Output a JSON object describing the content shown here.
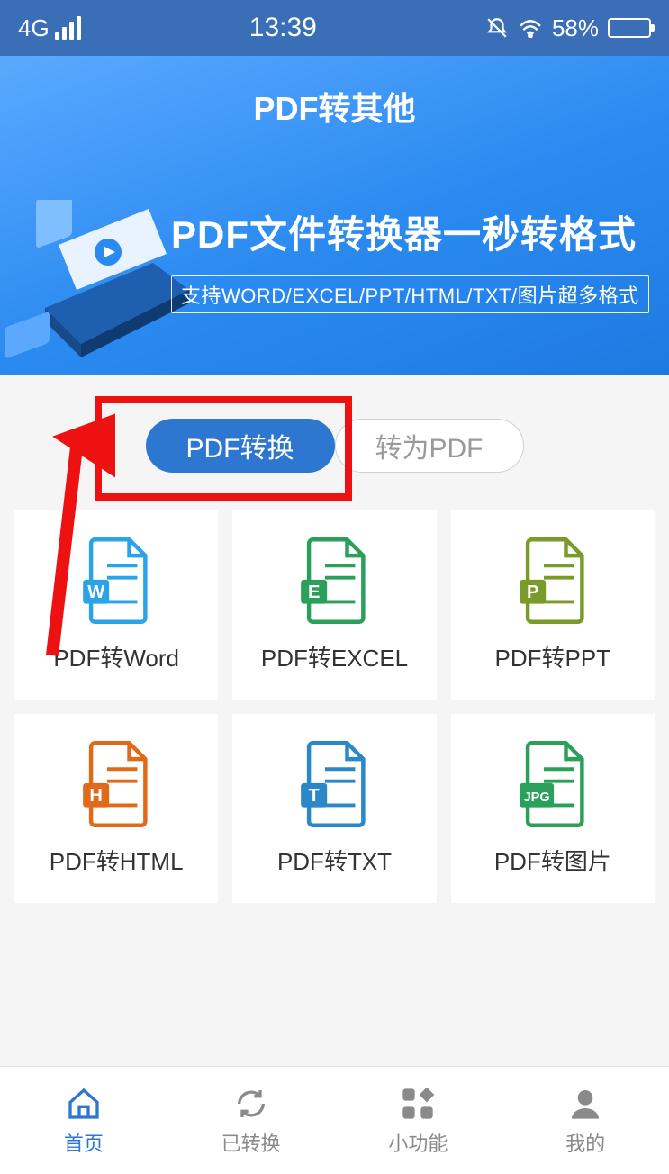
{
  "status": {
    "network": "4G",
    "time": "13:39",
    "battery_pct": "58%"
  },
  "header": {
    "title": "PDF转其他",
    "banner_main": "PDF文件转换器一秒转格式",
    "banner_sub": "支持WORD/EXCEL/PPT/HTML/TXT/图片超多格式"
  },
  "tabs": {
    "active": "PDF转换",
    "inactive": "转为PDF"
  },
  "tools": [
    {
      "label": "PDF转Word",
      "letter": "W",
      "color": "#2aa3e8"
    },
    {
      "label": "PDF转EXCEL",
      "letter": "E",
      "color": "#2aa05a"
    },
    {
      "label": "PDF转PPT",
      "letter": "P",
      "color": "#7a9a2a"
    },
    {
      "label": "PDF转HTML",
      "letter": "H",
      "color": "#e06a1a"
    },
    {
      "label": "PDF转TXT",
      "letter": "T",
      "color": "#2a88c8"
    },
    {
      "label": "PDF转图片",
      "letter": "JPG",
      "color": "#2aa05a"
    }
  ],
  "nav": {
    "items": [
      {
        "label": "首页",
        "name": "nav-home",
        "active": true
      },
      {
        "label": "已转换",
        "name": "nav-converted",
        "active": false
      },
      {
        "label": "小功能",
        "name": "nav-tools",
        "active": false
      },
      {
        "label": "我的",
        "name": "nav-profile",
        "active": false
      }
    ]
  }
}
